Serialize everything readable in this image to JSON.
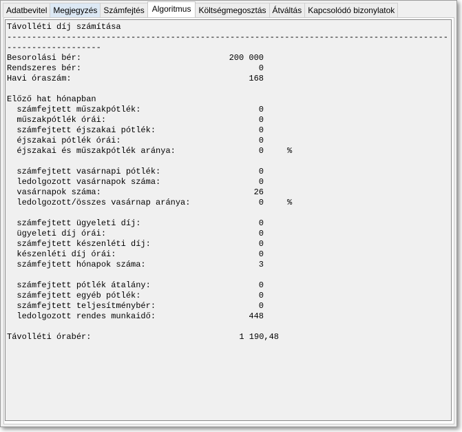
{
  "tabs": [
    {
      "label": "Adatbevitel",
      "state": "normal"
    },
    {
      "label": "Megjegyzés",
      "state": "hl"
    },
    {
      "label": "Számfejtés",
      "state": "normal"
    },
    {
      "label": "Algoritmus",
      "state": "active"
    },
    {
      "label": "Költségmegosztás",
      "state": "normal"
    },
    {
      "label": "Átváltás",
      "state": "normal"
    },
    {
      "label": "Kapcsolódó bizonylatok",
      "state": "normal"
    }
  ],
  "report": {
    "title": "Távolléti díj számítása",
    "separator": "------------------------------------------------------------------------------------------------------------",
    "rows": [
      {
        "label": "Besorolási bér:",
        "value": "200 000"
      },
      {
        "label": "Rendszeres bér:",
        "value": "0"
      },
      {
        "label": "Havi óraszám:",
        "value": "168"
      },
      null,
      {
        "label": "Előző hat hónapban"
      },
      {
        "label": "  számfejtett műszakpótlék:",
        "value": "0"
      },
      {
        "label": "  műszakpótlék órái:",
        "value": "0"
      },
      {
        "label": "  számfejtett éjszakai pótlék:",
        "value": "0"
      },
      {
        "label": "  éjszakai pótlék órái:",
        "value": "0"
      },
      {
        "label": "  éjszakai és műszakpótlék aránya:",
        "value": "0",
        "unit": "%"
      },
      null,
      {
        "label": "  számfejtett vasárnapi pótlék:",
        "value": "0"
      },
      {
        "label": "  ledolgozott vasárnapok száma:",
        "value": "0"
      },
      {
        "label": "  vasárnapok száma:",
        "value": "26"
      },
      {
        "label": "  ledolgozott/összes vasárnap aránya:",
        "value": "0",
        "unit": "%"
      },
      null,
      {
        "label": "  számfejtett ügyeleti díj:",
        "value": "0"
      },
      {
        "label": "  ügyeleti díj órái:",
        "value": "0"
      },
      {
        "label": "  számfejtett készenléti díj:",
        "value": "0"
      },
      {
        "label": "  készenléti díj órái:",
        "value": "0"
      },
      {
        "label": "  számfejtett hónapok száma:",
        "value": "3"
      },
      null,
      {
        "label": "  számfejtett pótlék átalány:",
        "value": "0"
      },
      {
        "label": "  számfejtett egyéb pótlék:",
        "value": "0"
      },
      {
        "label": "  számfejtett teljesítménybér:",
        "value": "0"
      },
      {
        "label": "  ledolgozott rendes munkaidő:",
        "value": "448"
      },
      null,
      {
        "label": "Távolléti órabér:",
        "value": "1 190,48",
        "wide": true
      }
    ]
  }
}
